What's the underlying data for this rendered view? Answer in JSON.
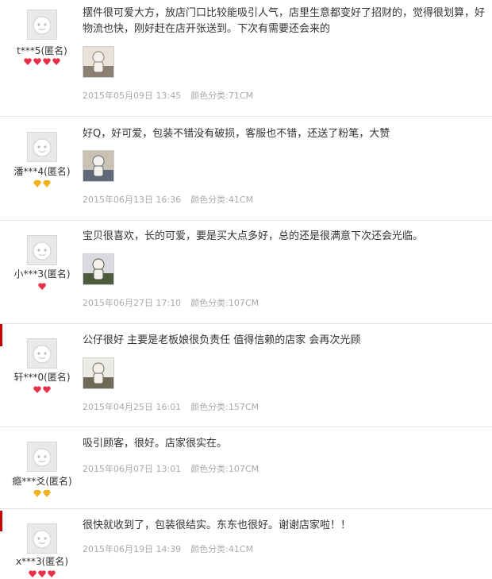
{
  "reviews": [
    {
      "user": "t***5(匿名)",
      "level": "red",
      "level_count": 4,
      "content": "摆件很可爱大方，放店门口比较能吸引人气，店里生意都变好了招财的，觉得很划算，好物流也快，刚好赶在店开张送到。下次有需要还会来的",
      "has_photo": true,
      "photo_colors": [
        "#8a7f72",
        "#e8e2d8"
      ],
      "date": "2015年05月09日 13:45",
      "spec": "颜色分类:71CM"
    },
    {
      "user": "潘***4(匿名)",
      "level": "gold",
      "level_count": 2,
      "content": "好Q，好可爱，包装不错没有破损，客服也不错，还送了粉笔，大赞",
      "has_photo": true,
      "photo_colors": [
        "#5e6a78",
        "#c9c2b4"
      ],
      "date": "2015年06月13日 16:36",
      "spec": "颜色分类:41CM"
    },
    {
      "user": "小***3(匿名)",
      "level": "red",
      "level_count": 1,
      "content": "宝贝很喜欢，长的可爱，要是买大点多好，总的还是很满意下次还会光临。",
      "has_photo": true,
      "photo_colors": [
        "#4d5a3c",
        "#d9dbe0"
      ],
      "date": "2015年06月27日 17:10",
      "spec": "颜色分类:107CM"
    },
    {
      "user": "轩***0(匿名)",
      "level": "red",
      "level_count": 2,
      "content": "公仔很好 主要是老板娘很负责任 值得信赖的店家 会再次光顾",
      "has_photo": true,
      "photo_colors": [
        "#6b6b58",
        "#eceae4"
      ],
      "date": "2015年04月25日 16:01",
      "spec": "颜色分类:157CM"
    },
    {
      "user": "瘾***爻(匿名)",
      "level": "gold",
      "level_count": 2,
      "content": "吸引顾客，很好。店家很实在。",
      "has_photo": false,
      "date": "2015年06月07日 13:01",
      "spec": "颜色分类:107CM"
    },
    {
      "user": "x***3(匿名)",
      "level": "red",
      "level_count": 3,
      "content": "很快就收到了，包装很结实。东东也很好。谢谢店家啦！！",
      "has_photo": false,
      "date": "2015年06月19日 14:39",
      "spec": "颜色分类:41CM"
    }
  ],
  "colors": {
    "accent": "#c40000",
    "badge_red": "#e8304a",
    "badge_gold": "#f3b21c",
    "meta_text": "#aaaaaa",
    "body_text": "#333333"
  }
}
